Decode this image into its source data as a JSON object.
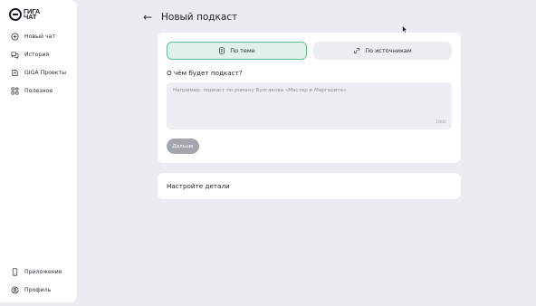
{
  "app": {
    "logo_text_line1": "ГИГА",
    "logo_text_line2": "ЧАТ"
  },
  "sidebar": {
    "items": [
      {
        "label": "Новый чат",
        "icon": "plus-circle-icon"
      },
      {
        "label": "История",
        "icon": "chat-bubbles-icon"
      },
      {
        "label": "GIGA Проекты",
        "icon": "projects-icon"
      },
      {
        "label": "Полезное",
        "icon": "grid-icon"
      }
    ],
    "bottom_items": [
      {
        "label": "Приложение",
        "icon": "phone-icon"
      },
      {
        "label": "Профиль",
        "icon": "profile-icon"
      }
    ]
  },
  "header": {
    "title": "Новый подкаст",
    "back_icon": "arrow-left-icon"
  },
  "tabs": [
    {
      "label": "По теме",
      "icon": "document-icon",
      "selected": true
    },
    {
      "label": "По источникам",
      "icon": "link-icon",
      "selected": false
    }
  ],
  "form": {
    "question": "О чём будет подкаст?",
    "placeholder": "Например: подкаст по роману Булгакова «Мастер и Маргарита»",
    "value": "",
    "counter": "1000",
    "next_label": "Дальше"
  },
  "details": {
    "label": "Настройте детали"
  },
  "colors": {
    "accent_border": "#5fbf96",
    "accent_fill": "#dff1e9",
    "background": "#eaecef",
    "button_disabled": "#a3a7ad"
  }
}
